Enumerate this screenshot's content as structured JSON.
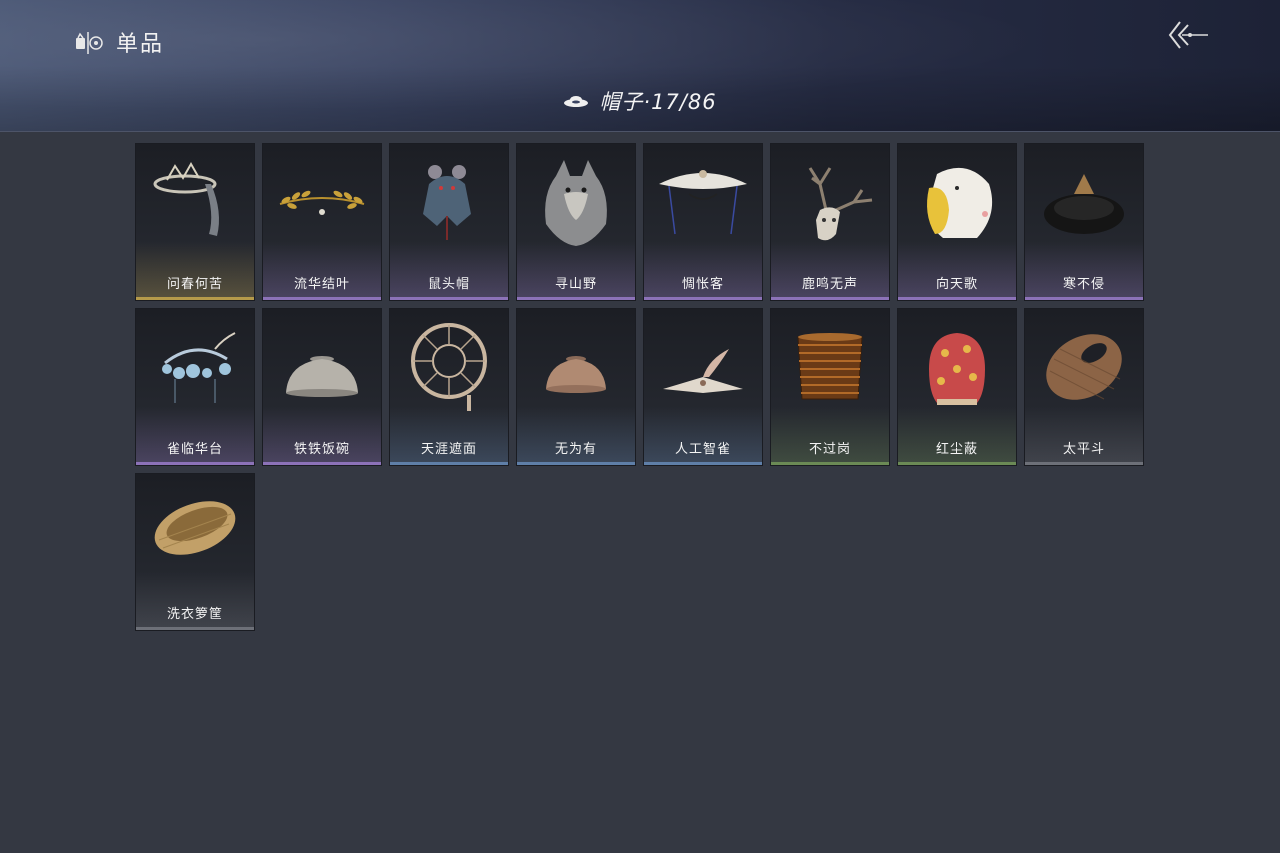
{
  "header": {
    "title": "单品",
    "category": "帽子·17/86"
  },
  "items": [
    {
      "name": "问春何苦",
      "rarity": "gold",
      "icon": "crown-veil-icon"
    },
    {
      "name": "流华结叶",
      "rarity": "purple",
      "icon": "laurel-wreath-icon"
    },
    {
      "name": "鼠头帽",
      "rarity": "purple",
      "icon": "rat-hood-icon"
    },
    {
      "name": "寻山野",
      "rarity": "purple",
      "icon": "wolf-head-icon"
    },
    {
      "name": "惆怅客",
      "rarity": "purple",
      "icon": "veiled-hat-icon"
    },
    {
      "name": "鹿鸣无声",
      "rarity": "purple",
      "icon": "deer-skull-icon"
    },
    {
      "name": "向天歌",
      "rarity": "purple",
      "icon": "goose-hood-icon"
    },
    {
      "name": "寒不侵",
      "rarity": "purple",
      "icon": "fur-hat-icon"
    },
    {
      "name": "雀临华台",
      "rarity": "purple",
      "icon": "flower-headdress-icon"
    },
    {
      "name": "铁铁饭碗",
      "rarity": "purple",
      "icon": "iron-bowl-icon"
    },
    {
      "name": "天涯遮面",
      "rarity": "blue",
      "icon": "rattan-frame-icon"
    },
    {
      "name": "无为有",
      "rarity": "blue",
      "icon": "clay-bowl-icon"
    },
    {
      "name": "人工智雀",
      "rarity": "blue",
      "icon": "bird-hat-icon"
    },
    {
      "name": "不过岗",
      "rarity": "green",
      "icon": "bowl-stack-icon"
    },
    {
      "name": "红尘蔽",
      "rarity": "green",
      "icon": "red-hood-icon"
    },
    {
      "name": "太平斗",
      "rarity": "gray",
      "icon": "bamboo-hat-icon"
    },
    {
      "name": "洗衣箩筐",
      "rarity": "gray",
      "icon": "wicker-basket-icon"
    }
  ],
  "rarity_colors": {
    "gold": "#b59a4a",
    "purple": "#8c72b8",
    "blue": "#5f7fa8",
    "green": "#6b8a55",
    "gray": "#6d7078"
  }
}
